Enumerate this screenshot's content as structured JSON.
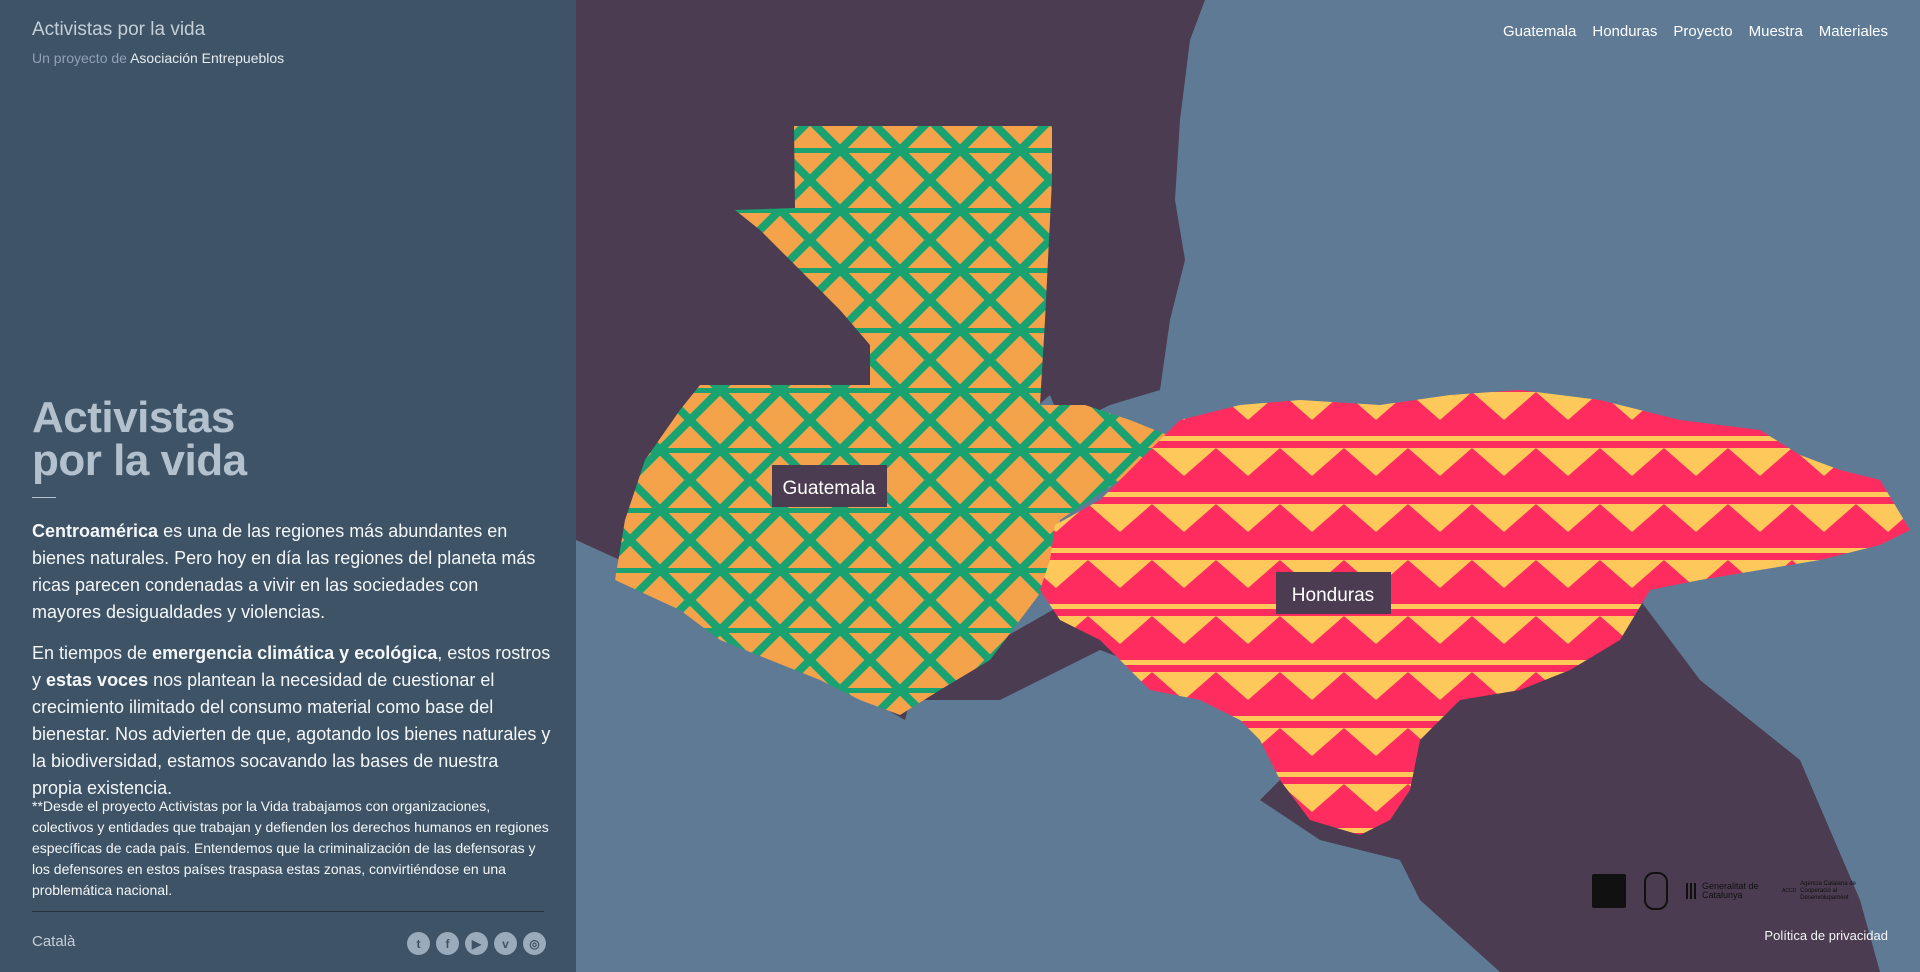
{
  "header": {
    "title": "Activistas por la vida",
    "subtitle_prefix": "Un proyecto de",
    "subtitle_org": "Asociación Entrepueblos"
  },
  "hero": {
    "line1": "Activistas",
    "line2": "por la vida"
  },
  "intro": {
    "p1_bold": "Centroamérica",
    "p1_rest": " es una de las regiones más abundantes en bienes naturales. Pero hoy en día las regiones del planeta más ricas parecen condenadas a vivir en las sociedades con mayores desigualdades y violencias.",
    "p2_a": "En tiempos de ",
    "p2_bold1": "emergencia climática y ecológica",
    "p2_b": ", estos rostros y ",
    "p2_bold2": "estas voces",
    "p2_c": " nos plantean la necesidad de cuestionar el crecimiento ilimitado del consumo material como base del bienestar. Nos advierten de que, agotando los bienes naturales y la biodiversidad, estamos socavando las bases de nuestra propia existencia."
  },
  "note": "**Desde el proyecto Activistas por la Vida trabajamos con organizaciones, colectivos y entidades que trabajan y defienden los derechos humanos en regiones específicas de cada país. Entendemos que la criminalización de las defensoras y los defensores en estos países traspasa estas zonas, convirtiéndose en una problemática nacional.",
  "footer": {
    "language": "Català",
    "privacy": "Política de privacidad",
    "social": [
      {
        "icon": "twitter-icon",
        "glyph": "t"
      },
      {
        "icon": "facebook-icon",
        "glyph": "f"
      },
      {
        "icon": "youtube-icon",
        "glyph": "▶"
      },
      {
        "icon": "vimeo-icon",
        "glyph": "v"
      },
      {
        "icon": "instagram-icon",
        "glyph": "◎"
      }
    ]
  },
  "nav": [
    "Guatemala",
    "Honduras",
    "Proyecto",
    "Muestra",
    "Materiales"
  ],
  "map": {
    "guatemala_label": "Guatemala",
    "honduras_label": "Honduras"
  },
  "logos": {
    "generalitat": "Generalitat de Catalunya",
    "accd": "Agència Catalana de Cooperació al Desenvolupament",
    "accd_mark": "ACCD"
  },
  "colors": {
    "sidebar": "#3e5466",
    "sea": "#5e7a94",
    "land": "#4b3c51",
    "gt_base": "#f4a34b",
    "gt_pattern": "#1aa371",
    "hn_base": "#ff2d5f",
    "hn_pattern": "#ffc85a"
  }
}
